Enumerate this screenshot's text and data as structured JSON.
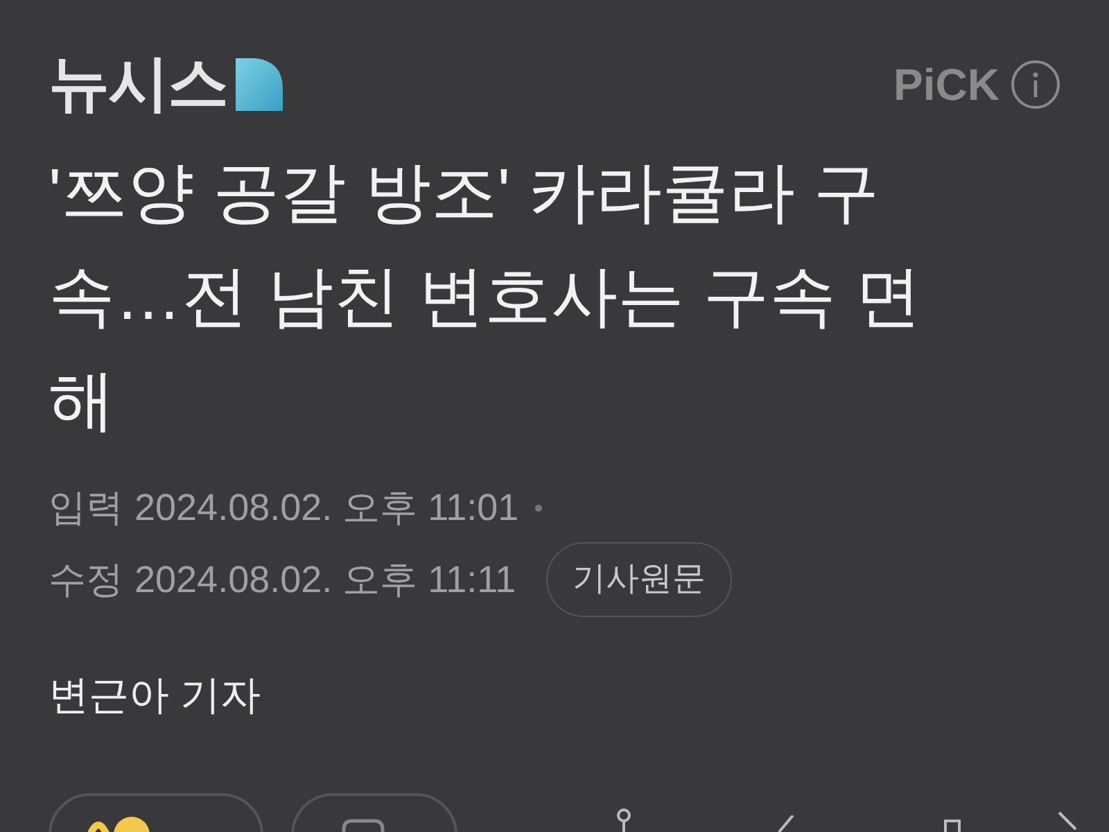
{
  "header": {
    "logo": "뉴시스",
    "pick": "PiCK"
  },
  "headline": "'쯔양 공갈 방조' 카라큘라 구속…전 남친 변호사는 구속 면해",
  "meta": {
    "input_label": "입력",
    "input_time": "2024.08.02. 오후 11:01",
    "edit_label": "수정",
    "edit_time": "2024.08.02. 오후 11:11",
    "original_button": "기사원문"
  },
  "reporter": "변근아 기자"
}
